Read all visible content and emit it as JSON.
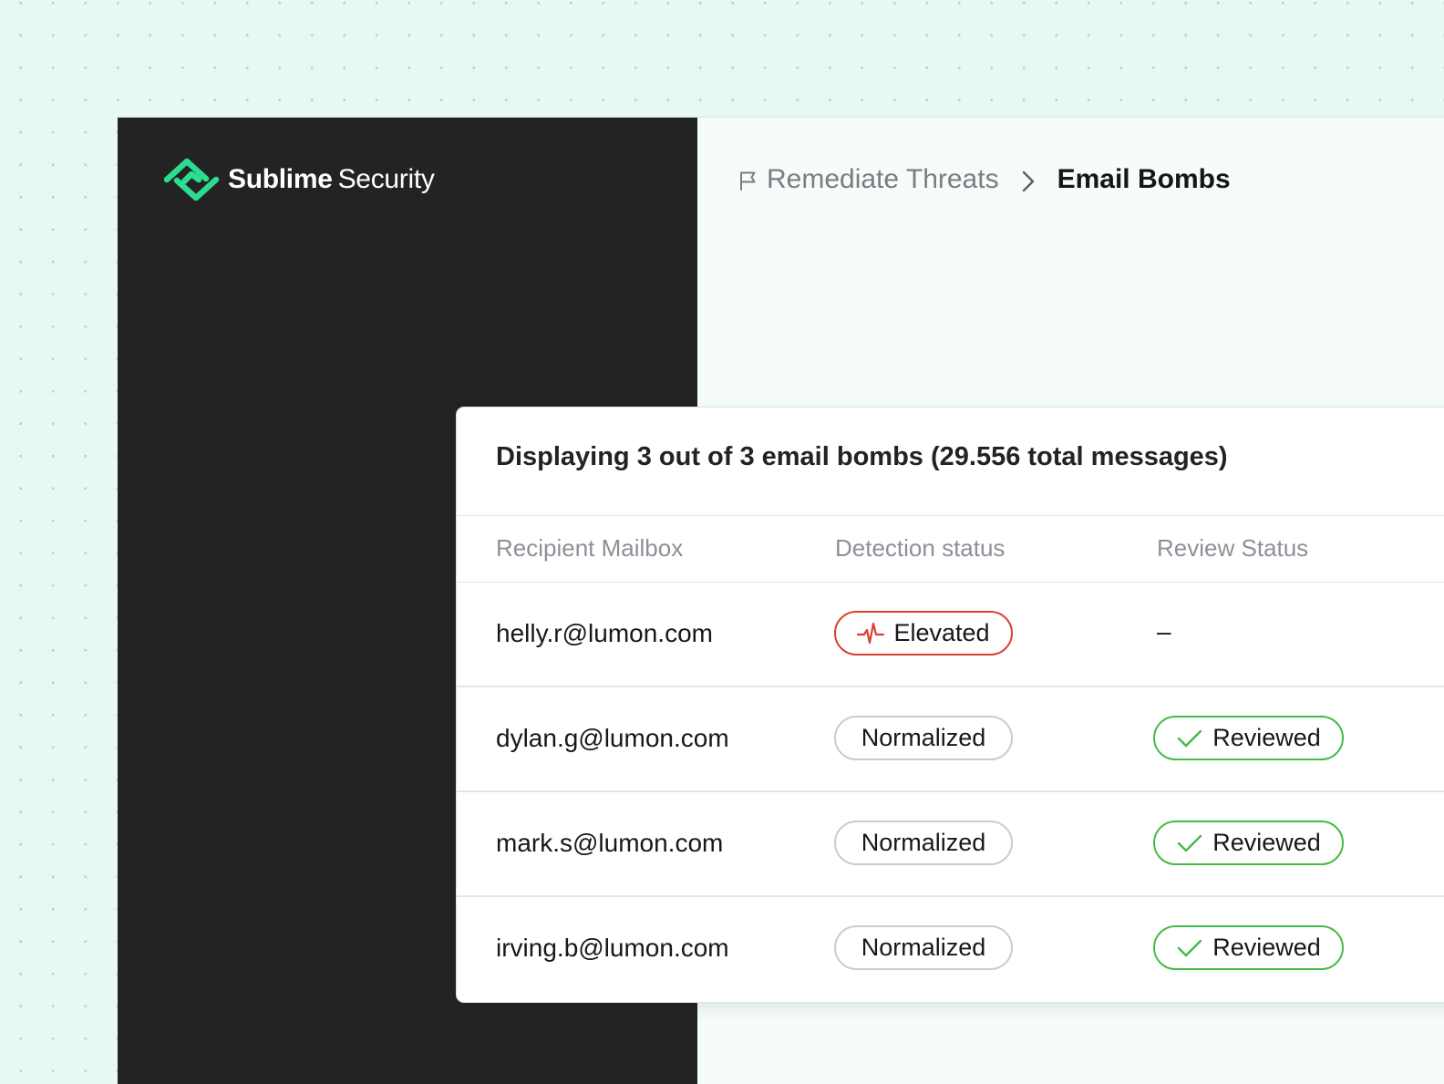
{
  "brand": {
    "name_primary": "Sublime",
    "name_secondary": "Security",
    "accent_color": "#2bdc91",
    "logo_icon": "sublime-security-logo-icon"
  },
  "breadcrumb": {
    "parent_icon": "flag-icon",
    "parent_label": "Remediate Threats",
    "separator_icon": "chevron-right-icon",
    "current_label": "Email Bombs"
  },
  "card": {
    "title": "Displaying 3 out of 3 email bombs (29.556 total messages)",
    "columns": [
      "Recipient Mailbox",
      "Detection status",
      "Review Status"
    ],
    "rows": [
      {
        "mailbox": "helly.r@lumon.com",
        "detection": {
          "label": "Elevated",
          "icon": "activity-pulse-icon",
          "color": "#db3f30"
        },
        "review": {
          "label": "–"
        }
      },
      {
        "mailbox": "dylan.g@lumon.com",
        "detection": {
          "label": "Normalized"
        },
        "review": {
          "label": "Reviewed",
          "icon": "checkmark-icon",
          "color": "#44bb44"
        }
      },
      {
        "mailbox": "mark.s@lumon.com",
        "detection": {
          "label": "Normalized"
        },
        "review": {
          "label": "Reviewed",
          "icon": "checkmark-icon",
          "color": "#44bb44"
        }
      },
      {
        "mailbox": "irving.b@lumon.com",
        "detection": {
          "label": "Normalized"
        },
        "review": {
          "label": "Reviewed",
          "icon": "checkmark-icon",
          "color": "#44bb44"
        }
      }
    ]
  }
}
